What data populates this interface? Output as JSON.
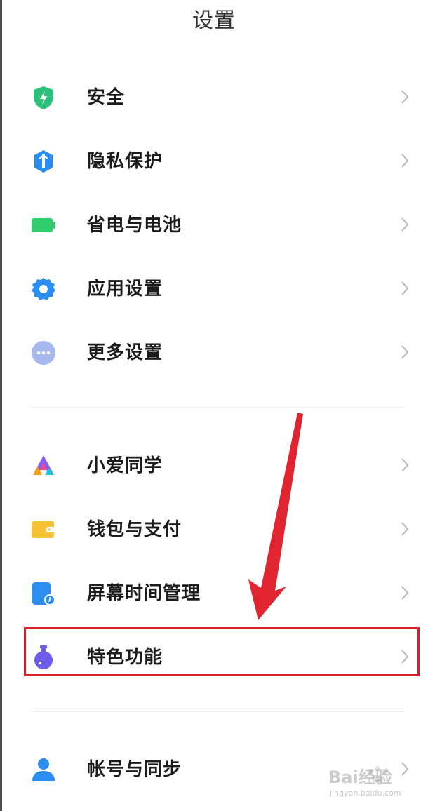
{
  "header": {
    "title": "设置"
  },
  "groups": [
    {
      "items": [
        {
          "label": "安全",
          "icon": "shield-icon",
          "color": "#2dbf7c"
        },
        {
          "label": "隐私保护",
          "icon": "privacy-icon",
          "color": "#2a8cf0"
        },
        {
          "label": "省电与电池",
          "icon": "battery-icon",
          "color": "#2fcf6f"
        },
        {
          "label": "应用设置",
          "icon": "gear-icon",
          "color": "#2b8ef0"
        },
        {
          "label": "更多设置",
          "icon": "more-icon",
          "color": "#a7b9ec"
        }
      ]
    },
    {
      "items": [
        {
          "label": "小爱同学",
          "icon": "xiaoai-icon",
          "color": "#8b5cf6"
        },
        {
          "label": "钱包与支付",
          "icon": "wallet-icon",
          "color": "#f5c236"
        },
        {
          "label": "屏幕时间管理",
          "icon": "screen-time-icon",
          "color": "#2b8ef0"
        },
        {
          "label": "特色功能",
          "icon": "flask-icon",
          "color": "#6b5de8"
        }
      ]
    },
    {
      "items": [
        {
          "label": "帐号与同步",
          "icon": "account-icon",
          "color": "#2b8ef0"
        }
      ]
    }
  ],
  "annotation": {
    "highlight_color": "#d81e2b",
    "arrow_color": "#e02530"
  },
  "watermark": {
    "text": "Bai经验",
    "url": "jingyan.baidu.com"
  }
}
